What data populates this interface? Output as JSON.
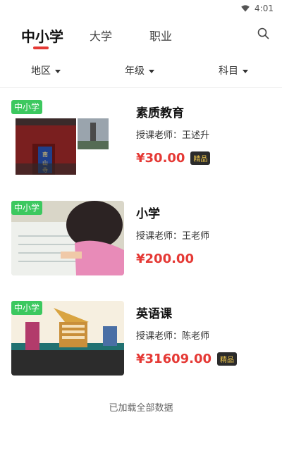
{
  "status_bar": {
    "time": "4:01",
    "wifi_icon": "wifi-icon"
  },
  "tabs": [
    {
      "label": "中小学",
      "active": true
    },
    {
      "label": "大学",
      "active": false
    },
    {
      "label": "职业",
      "active": false
    }
  ],
  "search_icon": "search-icon",
  "filters": [
    {
      "label": "地区"
    },
    {
      "label": "年级"
    },
    {
      "label": "科目"
    }
  ],
  "courses": [
    {
      "badge": "中小学",
      "title": "素质教育",
      "teacher": "授课老师：王述升",
      "price": "¥30.00",
      "tag": "精品"
    },
    {
      "badge": "中小学",
      "title": "小学",
      "teacher": "授课老师：王老师",
      "price": "¥200.00",
      "tag": ""
    },
    {
      "badge": "中小学",
      "title": "英语课",
      "teacher": "授课老师：陈老师",
      "price": "¥31609.00",
      "tag": "精品"
    }
  ],
  "footer": "已加载全部数据",
  "colors": {
    "accent": "#e53935",
    "badge_green": "#3cc85f",
    "premium_bg": "#2b2b2b",
    "premium_text": "#f2c94c"
  }
}
